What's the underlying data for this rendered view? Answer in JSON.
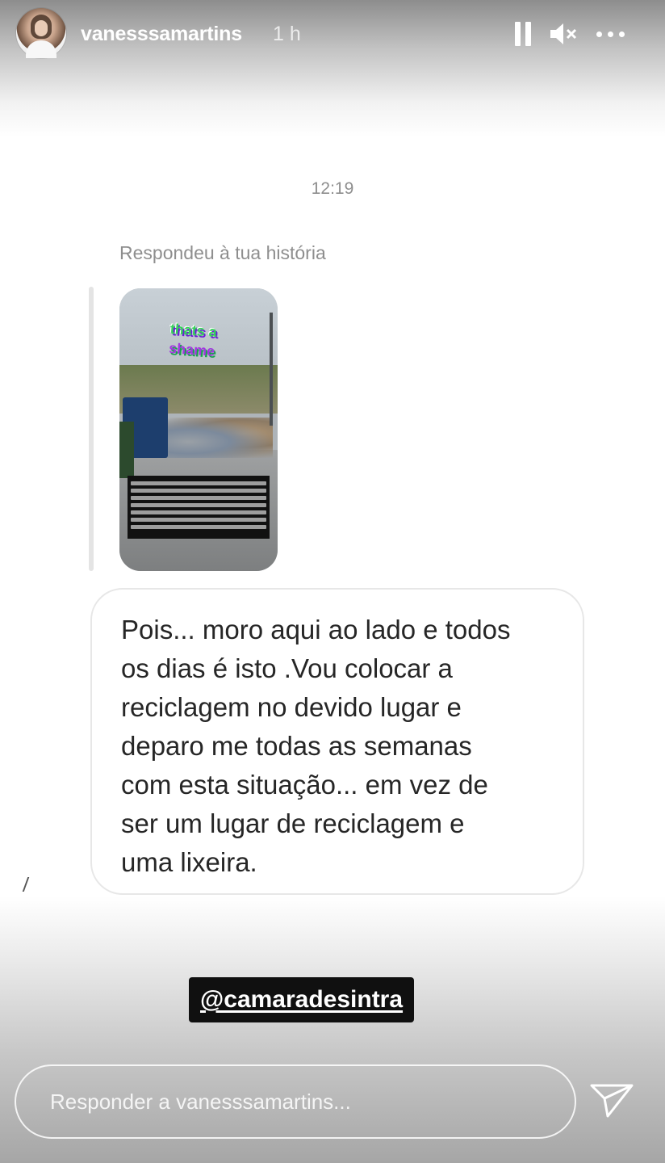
{
  "header": {
    "username": "vanesssamartins",
    "time_ago": "1 h",
    "icons": [
      "pause-icon",
      "mute-icon",
      "more-icon"
    ]
  },
  "dm": {
    "timestamp": "12:19",
    "reply_label": "Respondeu à tua história",
    "story_sticker_line1": "thats a",
    "story_sticker_line2": "shame",
    "message_lines": [
      "Pois... moro aqui ao lado e todos",
      "os dias é isto .Vou colocar a",
      "reciclagem no devido lugar e",
      "deparo me todas as semanas",
      "com esta situação... em vez de",
      "ser um lugar de reciclagem e",
      "uma lixeira."
    ]
  },
  "mention": "@camaradesintra",
  "reply": {
    "placeholder": "Responder a vanesssamartins..."
  },
  "colors": {
    "bubble_border": "#e7e7e7",
    "meta_text": "#8e8e8e",
    "message_text": "#262626",
    "mention_bg": "#101010"
  }
}
